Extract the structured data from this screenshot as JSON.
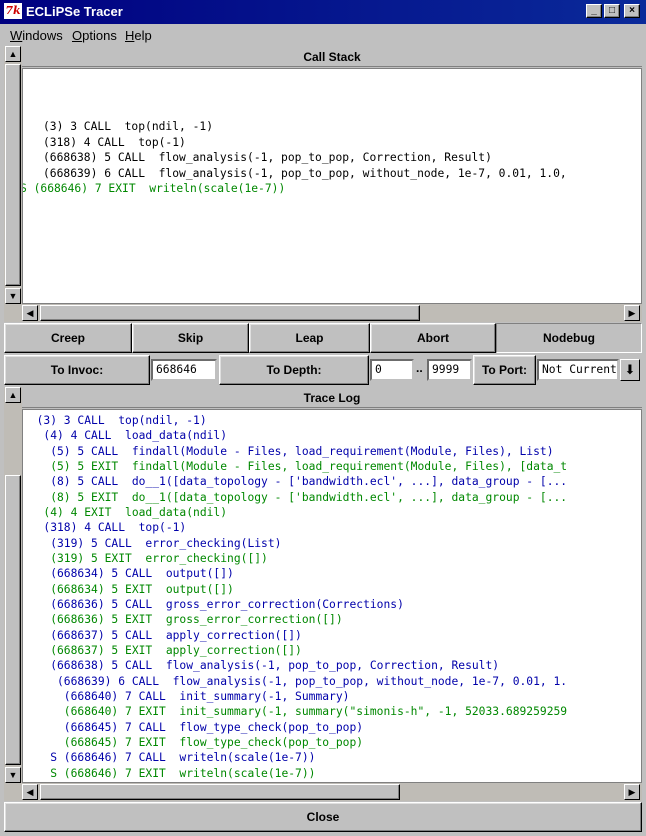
{
  "window": {
    "title": "ECLiPSe Tracer",
    "app_icon": "tk-icon",
    "icon_text": "7k",
    "minimize": "_",
    "maximize": "□",
    "close": "×"
  },
  "menu": [
    "Windows",
    "Options",
    "Help"
  ],
  "call_stack": {
    "title": "Call Stack",
    "lines": [
      {
        "text": "(3) 3 CALL  top(ndil, -1)",
        "kind": "black"
      },
      {
        "text": "(318) 4 CALL  top(-1)",
        "kind": "black"
      },
      {
        "text": "(668638) 5 CALL  flow_analysis(-1, pop_to_pop, Correction, Result)",
        "kind": "black"
      },
      {
        "text": "(668639) 6 CALL  flow_analysis(-1, pop_to_pop, without_node, 1e-7, 0.01, 1.0, ",
        "kind": "black"
      },
      {
        "text": "S (668646) 7 EXIT  writeln(scale(1e-7))",
        "kind": "exit"
      }
    ]
  },
  "controls": {
    "creep": "Creep",
    "skip": "Skip",
    "leap": "Leap",
    "abort": "Abort",
    "nodebug": "Nodebug",
    "to_invoc": "To Invoc:",
    "invoc_value": "668646",
    "to_depth": "To Depth:",
    "depth_min": "0",
    "depth_sep": "..",
    "depth_max": "9999",
    "to_port": "To Port:",
    "port_value": "Not Current"
  },
  "trace_log": {
    "title": "Trace Log",
    "lines": [
      {
        "text": "  (3) 3 CALL  top(ndil, -1)",
        "kind": "call"
      },
      {
        "text": "   (4) 4 CALL  load_data(ndil)",
        "kind": "call"
      },
      {
        "text": "    (5) 5 CALL  findall(Module - Files, load_requirement(Module, Files), List)",
        "kind": "call"
      },
      {
        "text": "    (5) 5 EXIT  findall(Module - Files, load_requirement(Module, Files), [data_t",
        "kind": "exit"
      },
      {
        "text": "    (8) 5 CALL  do__1([data_topology - ['bandwidth.ecl', ...], data_group - [...",
        "kind": "call"
      },
      {
        "text": "    (8) 5 EXIT  do__1([data_topology - ['bandwidth.ecl', ...], data_group - [...",
        "kind": "exit"
      },
      {
        "text": "   (4) 4 EXIT  load_data(ndil)",
        "kind": "exit"
      },
      {
        "text": "   (318) 4 CALL  top(-1)",
        "kind": "call"
      },
      {
        "text": "    (319) 5 CALL  error_checking(List)",
        "kind": "call"
      },
      {
        "text": "    (319) 5 EXIT  error_checking([])",
        "kind": "exit"
      },
      {
        "text": "    (668634) 5 CALL  output([])",
        "kind": "call"
      },
      {
        "text": "    (668634) 5 EXIT  output([])",
        "kind": "exit"
      },
      {
        "text": "    (668636) 5 CALL  gross_error_correction(Corrections)",
        "kind": "call"
      },
      {
        "text": "    (668636) 5 EXIT  gross_error_correction([])",
        "kind": "exit"
      },
      {
        "text": "    (668637) 5 CALL  apply_correction([])",
        "kind": "call"
      },
      {
        "text": "    (668637) 5 EXIT  apply_correction([])",
        "kind": "exit"
      },
      {
        "text": "    (668638) 5 CALL  flow_analysis(-1, pop_to_pop, Correction, Result)",
        "kind": "call"
      },
      {
        "text": "     (668639) 6 CALL  flow_analysis(-1, pop_to_pop, without_node, 1e-7, 0.01, 1.",
        "kind": "call"
      },
      {
        "text": "      (668640) 7 CALL  init_summary(-1, Summary)",
        "kind": "call"
      },
      {
        "text": "      (668640) 7 EXIT  init_summary(-1, summary(\"simonis-h\", -1, 52033.689259259",
        "kind": "exit"
      },
      {
        "text": "      (668645) 7 CALL  flow_type_check(pop_to_pop)",
        "kind": "call"
      },
      {
        "text": "      (668645) 7 EXIT  flow_type_check(pop_to_pop)",
        "kind": "exit"
      },
      {
        "text": "    S (668646) 7 CALL  writeln(scale(1e-7))",
        "kind": "call"
      },
      {
        "text": "    S (668646) 7 EXIT  writeln(scale(1e-7))",
        "kind": "exit"
      }
    ]
  },
  "footer": {
    "close": "Close"
  },
  "arrows": {
    "up": "▲",
    "down": "▼",
    "left": "◀",
    "right": "▶",
    "dropdown": "⬇"
  }
}
